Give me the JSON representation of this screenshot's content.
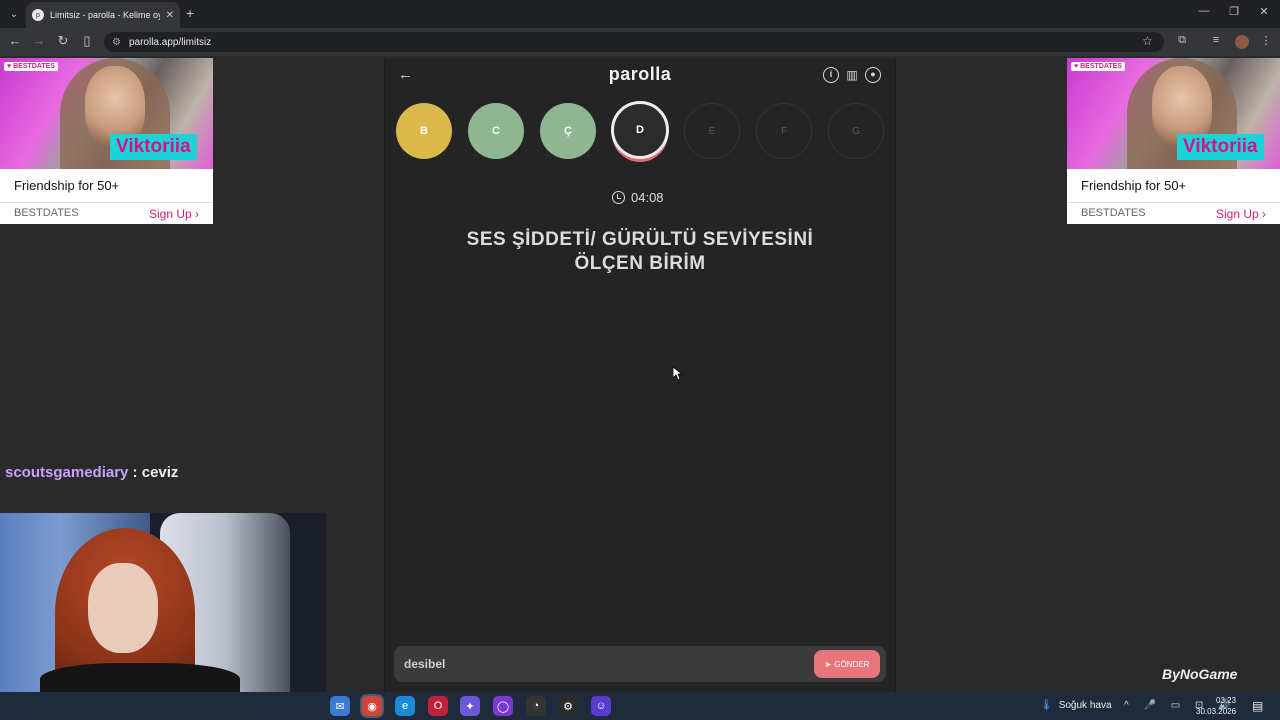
{
  "browser": {
    "tab_title": "Limitsiz - parolla - Kelime oyunu",
    "url": "parolla.app/limitsiz",
    "new_tab": "+",
    "tab_close": "✕"
  },
  "ads": {
    "brand": "♥ BESTDATES",
    "name": "Viktoriia",
    "headline": "Friendship for 50+",
    "brand_footer": "BESTDATES",
    "cta": "Sign Up ›"
  },
  "game": {
    "logo": "parolla",
    "letters": [
      {
        "letter": "B",
        "state": "yellow"
      },
      {
        "letter": "C",
        "state": "green"
      },
      {
        "letter": "Ç",
        "state": "green"
      },
      {
        "letter": "D",
        "state": "current"
      },
      {
        "letter": "E",
        "state": "empty"
      },
      {
        "letter": "F",
        "state": "empty"
      },
      {
        "letter": "G",
        "state": "empty"
      }
    ],
    "timer": "04:08",
    "question_line1": "SES ŞİDDETİ/ GÜRÜLTÜ SEVİYESİNİ",
    "question_line2": "ÖLÇEN BİRİM",
    "answer_value": "desibel",
    "send_label": "GÖNDER"
  },
  "chat": {
    "user": "scoutsgamediary",
    "separator": " : ",
    "message": "ceviz"
  },
  "watermark": "ByNoGame",
  "taskbar": {
    "weather": "Soğuk hava",
    "time": "03:23",
    "date": "30.03.2026"
  },
  "colors": {
    "yellow": "#d8b94a",
    "green": "#8fb592",
    "accent": "#e8747c",
    "ad_pink": "#d0207a"
  }
}
